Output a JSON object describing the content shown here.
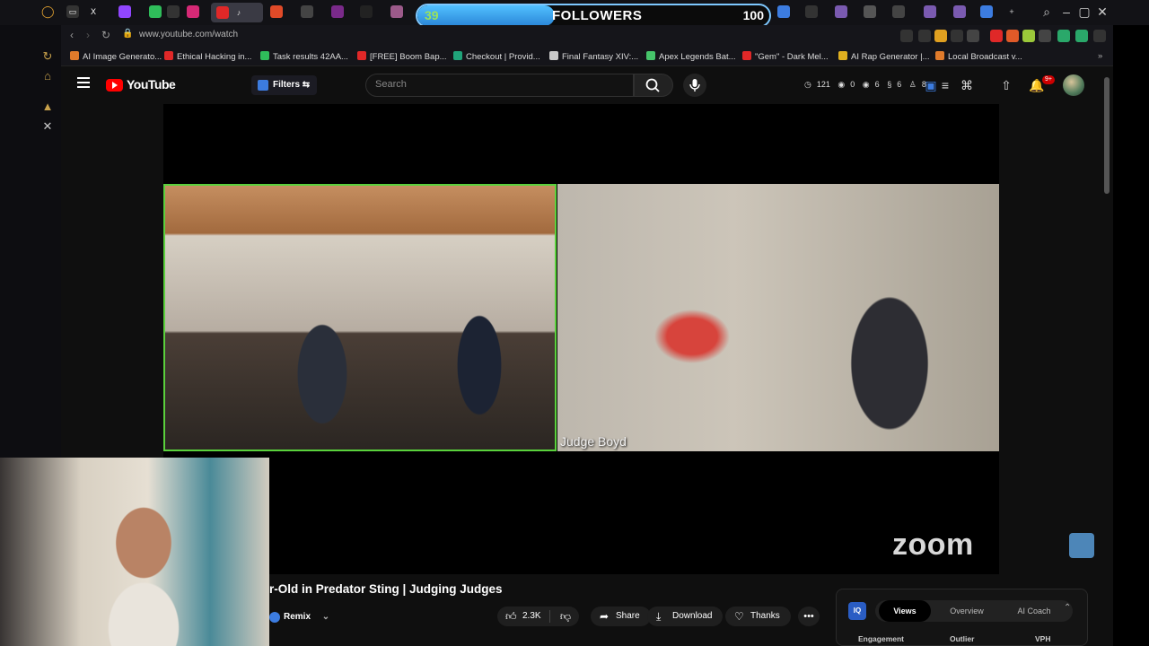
{
  "browser": {
    "followers_goal": {
      "current": "39",
      "label": "FOLLOWERS",
      "target": "100",
      "progress_fraction": 0.39
    },
    "url": "www.youtube.com/watch",
    "bookmarks": [
      {
        "label": "AI Image Generato...",
        "color": "#e07b2b"
      },
      {
        "label": "Ethical Hacking in...",
        "color": "#e02828"
      },
      {
        "label": "Task results 42AA...",
        "color": "#2fbd5a"
      },
      {
        "label": "[FREE] Boom Bap...",
        "color": "#e02828"
      },
      {
        "label": "Checkout | Provid...",
        "color": "#20a37a"
      },
      {
        "label": "Final Fantasy XIV:...",
        "color": "#c9c9c9"
      },
      {
        "label": "Apex Legends Bat...",
        "color": "#46c46a"
      },
      {
        "label": "\"Gem\" - Dark Mel...",
        "color": "#e02828"
      },
      {
        "label": "AI Rap Generator |...",
        "color": "#e0b020"
      },
      {
        "label": "Local Broadcast v...",
        "color": "#e07b2b"
      }
    ]
  },
  "youtube": {
    "logo_text": "YouTube",
    "filters_label": "Filters",
    "search_placeholder": "Search",
    "stats": {
      "views": "121",
      "a": "0",
      "b": "6",
      "c": "6",
      "d": "8"
    },
    "notifications_badge": "9+"
  },
  "video": {
    "participant_label": "Judge Boyd",
    "zoom_watermark": "zoom",
    "title": "r-Old in Predator Sting | Judging Judges",
    "remix_label": "Remix",
    "likes": "2.3K",
    "share_label": "Share",
    "download_label": "Download",
    "thanks_label": "Thanks"
  },
  "analytics_panel": {
    "logo": "IQ",
    "tabs": [
      "Views",
      "Overview",
      "AI Coach"
    ],
    "active_tab": "Views",
    "columns": [
      "Engagement",
      "Outlier",
      "VPH"
    ]
  }
}
